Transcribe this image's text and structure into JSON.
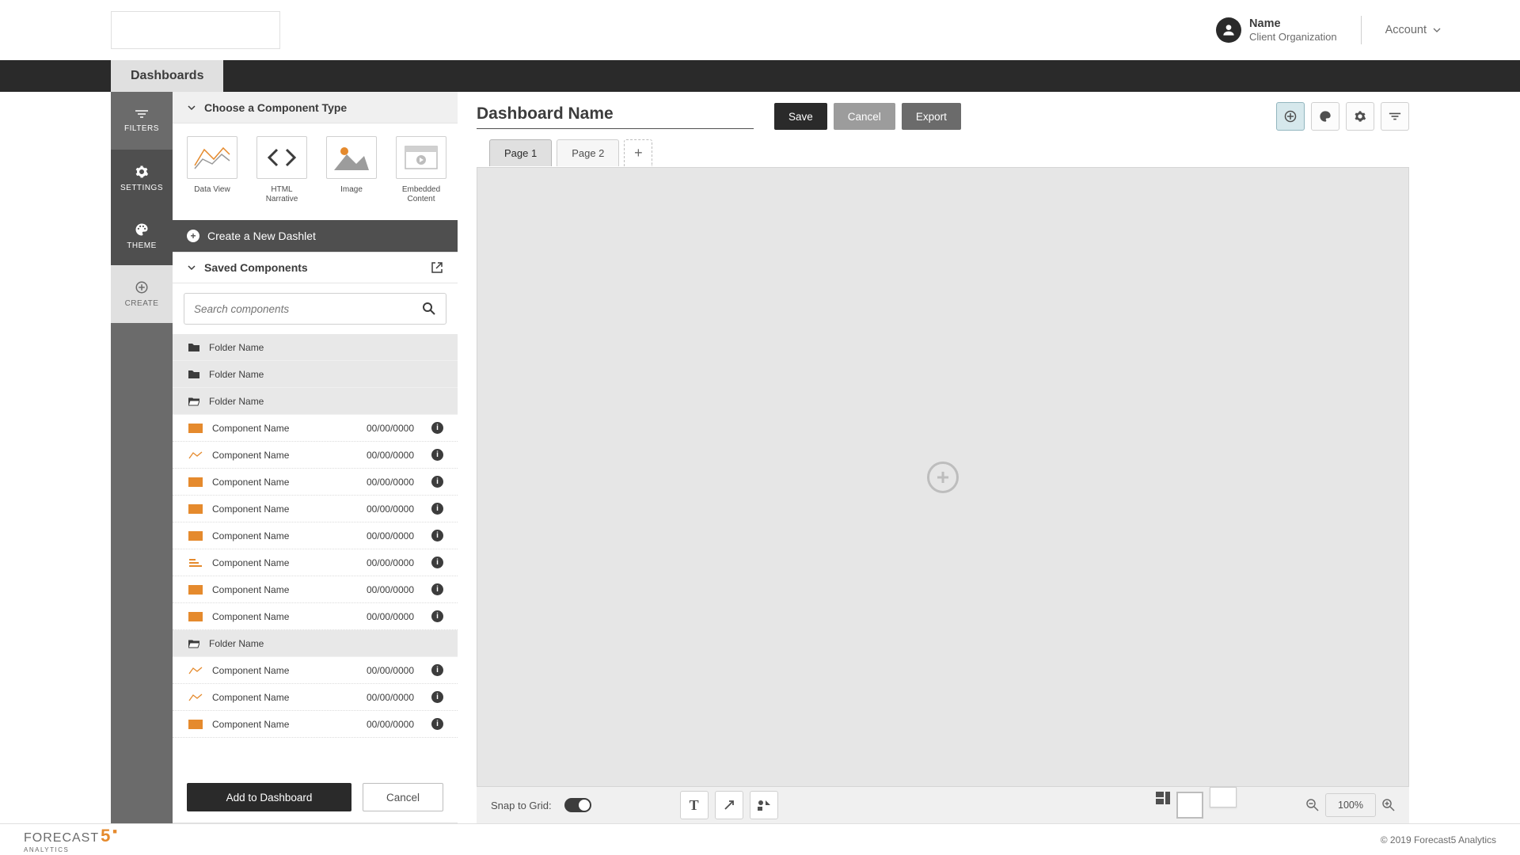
{
  "header": {
    "user_name": "Name",
    "user_org": "Client Organization",
    "account_label": "Account"
  },
  "nav": {
    "dashboards_tab": "Dashboards"
  },
  "mini_sidebar": {
    "filters": "FILTERS",
    "settings": "SETTINGS",
    "theme": "THEME",
    "create": "CREATE"
  },
  "panel": {
    "section_choose": "Choose a Component Type",
    "types": {
      "data_view": "Data View",
      "html_narrative": "HTML Narrative",
      "image": "Image",
      "embedded": "Embedded Content"
    },
    "create_dashlet": "Create a New Dashlet",
    "section_saved": "Saved Components",
    "search_placeholder": "Search components",
    "folders": [
      "Folder Name",
      "Folder Name",
      "Folder Name"
    ],
    "folder2": "Folder Name",
    "components_top": [
      {
        "name": "Component Name",
        "date": "00/00/0000",
        "icon": "bar"
      },
      {
        "name": "Component Name",
        "date": "00/00/0000",
        "icon": "line"
      },
      {
        "name": "Component Name",
        "date": "00/00/0000",
        "icon": "bar"
      },
      {
        "name": "Component Name",
        "date": "00/00/0000",
        "icon": "bar"
      },
      {
        "name": "Component Name",
        "date": "00/00/0000",
        "icon": "bar"
      },
      {
        "name": "Component Name",
        "date": "00/00/0000",
        "icon": "steps"
      },
      {
        "name": "Component Name",
        "date": "00/00/0000",
        "icon": "bar"
      },
      {
        "name": "Component Name",
        "date": "00/00/0000",
        "icon": "bar"
      }
    ],
    "components_bottom": [
      {
        "name": "Component Name",
        "date": "00/00/0000",
        "icon": "line"
      },
      {
        "name": "Component Name",
        "date": "00/00/0000",
        "icon": "line"
      },
      {
        "name": "Component Name",
        "date": "00/00/0000",
        "icon": "bar"
      }
    ],
    "add_btn": "Add to Dashboard",
    "cancel_btn": "Cancel"
  },
  "canvas": {
    "title": "Dashboard Name",
    "save": "Save",
    "cancel": "Cancel",
    "export": "Export",
    "page1": "Page 1",
    "page2": "Page 2",
    "snap_label": "Snap to Grid:",
    "zoom": "100%"
  },
  "footer": {
    "brand_text": "FORECAST",
    "brand_sub": "ANALYTICS",
    "copyright": "© 2019 Forecast5 Analytics"
  }
}
